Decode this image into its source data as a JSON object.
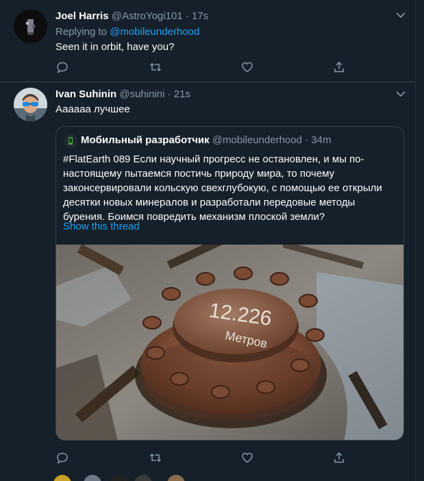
{
  "tweet1": {
    "name": "Joel Harris",
    "handle": "@AstroYogi101",
    "separator": "·",
    "time": "17s",
    "replying_prefix": "Replying to ",
    "replying_to": "@mobileunderhood",
    "text": "Seen it in orbit, have you?"
  },
  "tweet2": {
    "name": "Ivan Suhinin",
    "handle": "@suhinini",
    "separator": "·",
    "time": "21s",
    "text": "Аааааа лучшее",
    "quote": {
      "name": "Мобильный разработчик",
      "handle": "@mobileunderhood",
      "separator": "·",
      "time": "34m",
      "text": "#FlatEarth 089 Если научный прогресс не остановлен, и мы по-настоящему пытаемся постичь природу мира, то почему законсервировали кольскую свехглубокую, с помощью ее открыли десятки новых минералов и разработали передовые методы бурения. Боимся повредить механизм плоской земли?",
      "show_thread": "Show this thread",
      "photo_inscription_1": "12.226",
      "photo_inscription_2": "Метров"
    }
  },
  "icons": {
    "reply": "reply-icon",
    "retweet": "retweet-icon",
    "like": "heart-icon",
    "share": "share-icon",
    "caret": "chevron-down-icon"
  },
  "colors": {
    "background": "#15202b",
    "border": "#38444d",
    "secondary_text": "#8899a6",
    "link": "#1da1f2"
  }
}
